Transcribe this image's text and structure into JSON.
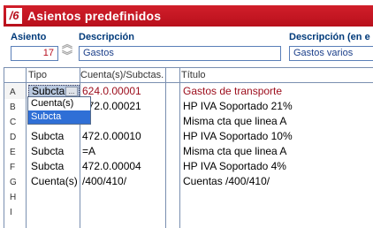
{
  "window": {
    "title": "Asientos predefinidos",
    "logo": "/6"
  },
  "header": {
    "asiento_label": "Asiento",
    "asiento_value": "17",
    "descripcion_label": "Descripción",
    "descripcion_value": "Gastos",
    "descripcion_en_label": "Descripción (en e",
    "descripcion_en_value": "Gastos varios"
  },
  "grid": {
    "columns": [
      "Tipo",
      "Cuenta(s)/Subctas.",
      "Título"
    ],
    "rows": [
      {
        "letter": "A",
        "tipo": "Subcta",
        "cuenta": "624.0.00001",
        "titulo": "Gastos de transporte"
      },
      {
        "letter": "B",
        "tipo": "",
        "cuenta": "472.0.00021",
        "titulo": "HP IVA Soportado 21%"
      },
      {
        "letter": "C",
        "tipo": "",
        "cuenta": "",
        "titulo": "Misma cta que linea A"
      },
      {
        "letter": "D",
        "tipo": "Subcta",
        "cuenta": "472.0.00010",
        "titulo": "HP IVA Soportado 10%"
      },
      {
        "letter": "E",
        "tipo": "Subcta",
        "cuenta": "=A",
        "titulo": "Misma cta que linea A"
      },
      {
        "letter": "F",
        "tipo": "Subcta",
        "cuenta": "472.0.00004",
        "titulo": "HP IVA Soportado 4%"
      },
      {
        "letter": "G",
        "tipo": "Cuenta(s)",
        "cuenta": "/400/410/",
        "titulo": "Cuentas /400/410/"
      },
      {
        "letter": "H",
        "tipo": "",
        "cuenta": "",
        "titulo": ""
      },
      {
        "letter": "I",
        "tipo": "",
        "cuenta": "",
        "titulo": ""
      }
    ]
  },
  "dropdown": {
    "options": [
      "Cuenta(s)",
      "Subcta"
    ],
    "selected": "Subcta",
    "button_glyph": "..."
  },
  "colors": {
    "titlebar": "#c8161f",
    "highlight": "#2f6fd6",
    "accent_text": "#9b0b1a"
  }
}
